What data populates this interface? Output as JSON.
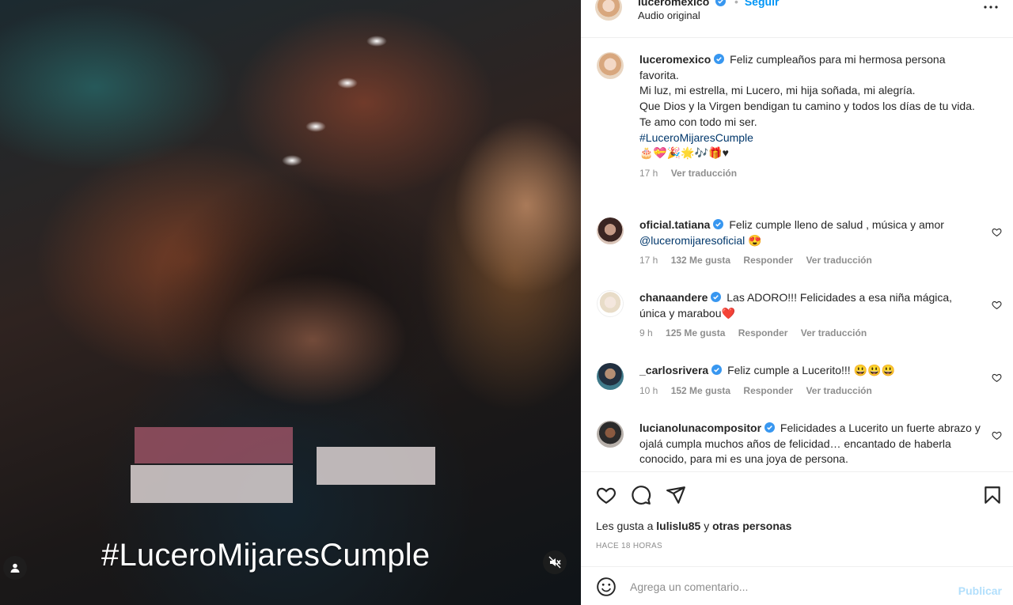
{
  "media": {
    "overlay_text": "#LuceroMijaresCumple",
    "icons": [
      "user-tag-icon",
      "muted-speaker-icon"
    ]
  },
  "header": {
    "username": "luceromexico",
    "follow_label": "Seguir",
    "audio_label": "Audio original",
    "more_icon": "more-options-icon"
  },
  "caption": {
    "username": "luceromexico",
    "lines": [
      "Feliz cumpleaños para mi hermosa persona favorita.",
      "Mi luz, mi estrella, mi Lucero, mi hija soñada, mi alegría.",
      "Que Dios y la Virgen bendigan tu camino y todos los días de tu vida.",
      "Te amo con todo mi ser."
    ],
    "hashtag": "#LuceroMijaresCumple",
    "emojis": "🎂💝🎉🌟🎶🎁♥",
    "time": "17 h",
    "translate": "Ver traducción"
  },
  "comments": [
    {
      "username": "oficial.tatiana",
      "text": "Feliz cumple lleno de salud , música y amor",
      "mention": "@luceromijaresoficial",
      "emoji": "😍",
      "time": "17 h",
      "likes": "132 Me gusta",
      "reply": "Responder",
      "translate": "Ver traducción"
    },
    {
      "username": "chanaandere",
      "text": "Las ADORO!!! Felicidades a esa niña mágica, única y marabou",
      "emoji": "❤️",
      "time": "9 h",
      "likes": "125 Me gusta",
      "reply": "Responder",
      "translate": "Ver traducción"
    },
    {
      "username": "_carlosrivera",
      "text": "Feliz cumple a Lucerito!!! 😃😃😃",
      "time": "10 h",
      "likes": "152 Me gusta",
      "reply": "Responder",
      "translate": "Ver traducción"
    },
    {
      "username": "lucianolunacompositor",
      "text": "Felicidades a Lucerito un fuerte abrazo y ojalá cumpla muchos años de felicidad… encantado de haberla conocido, para mi es una joya de persona."
    }
  ],
  "actions": {
    "icons": [
      "like-heart-icon",
      "comment-icon",
      "share-icon",
      "save-bookmark-icon"
    ],
    "likes_prefix": "Les gusta a",
    "likes_user": "lulislu85",
    "likes_joiner": "y",
    "likes_others": "otras personas",
    "posted": "HACE 18 HORAS"
  },
  "add_comment": {
    "placeholder": "Agrega un comentario...",
    "publish_label": "Publicar",
    "icon": "emoji-smiley-icon"
  },
  "colors": {
    "link": "#00376b",
    "verified": "#3897f0",
    "muted": "#8e8e8e",
    "publish_disabled": "#b2dffc",
    "emoji_heart": "#ed4956"
  }
}
